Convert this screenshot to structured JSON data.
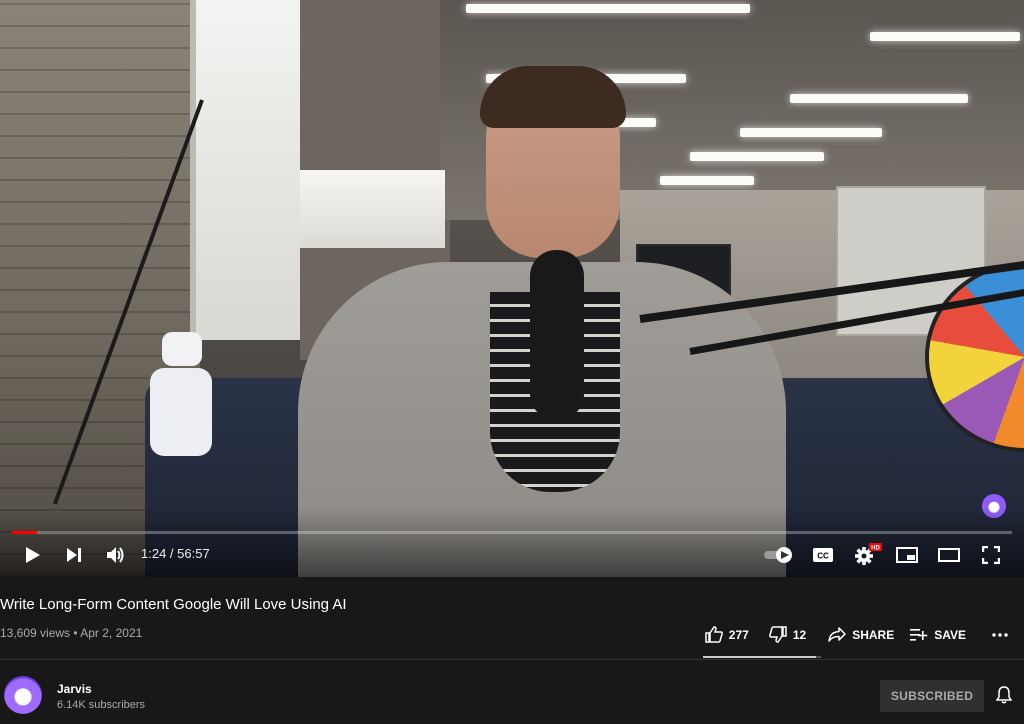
{
  "player": {
    "current_time": "1:24",
    "duration": "56:57",
    "time_display": "1:24 / 56:57",
    "progress_fraction": 0.025,
    "hd_badge": "HD",
    "cc_label": "CC",
    "accent_color": "#ff0000"
  },
  "video": {
    "title": "Write Long-Form Content Google Will Love Using AI",
    "views": "13,609 views",
    "date": "Apr 2, 2021",
    "meta_line": "13,609 views • Apr 2, 2021"
  },
  "actions": {
    "like_count": "277",
    "dislike_count": "12",
    "share_label": "SHARE",
    "save_label": "SAVE",
    "like_fraction": 0.958
  },
  "channel": {
    "name": "Jarvis",
    "subscribers": "6.14K subscribers",
    "subscribe_label": "SUBSCRIBED"
  },
  "icons": {
    "play": "play-icon",
    "next": "next-icon",
    "volume": "volume-icon",
    "autoplay": "autoplay-toggle-icon",
    "captions": "captions-icon",
    "settings": "gear-icon",
    "miniplayer": "miniplayer-icon",
    "theater": "theater-icon",
    "fullscreen": "fullscreen-icon",
    "like": "thumbs-up-icon",
    "dislike": "thumbs-down-icon",
    "share": "share-icon",
    "save": "playlist-add-icon",
    "more": "more-horizontal-icon",
    "bell": "bell-icon"
  }
}
